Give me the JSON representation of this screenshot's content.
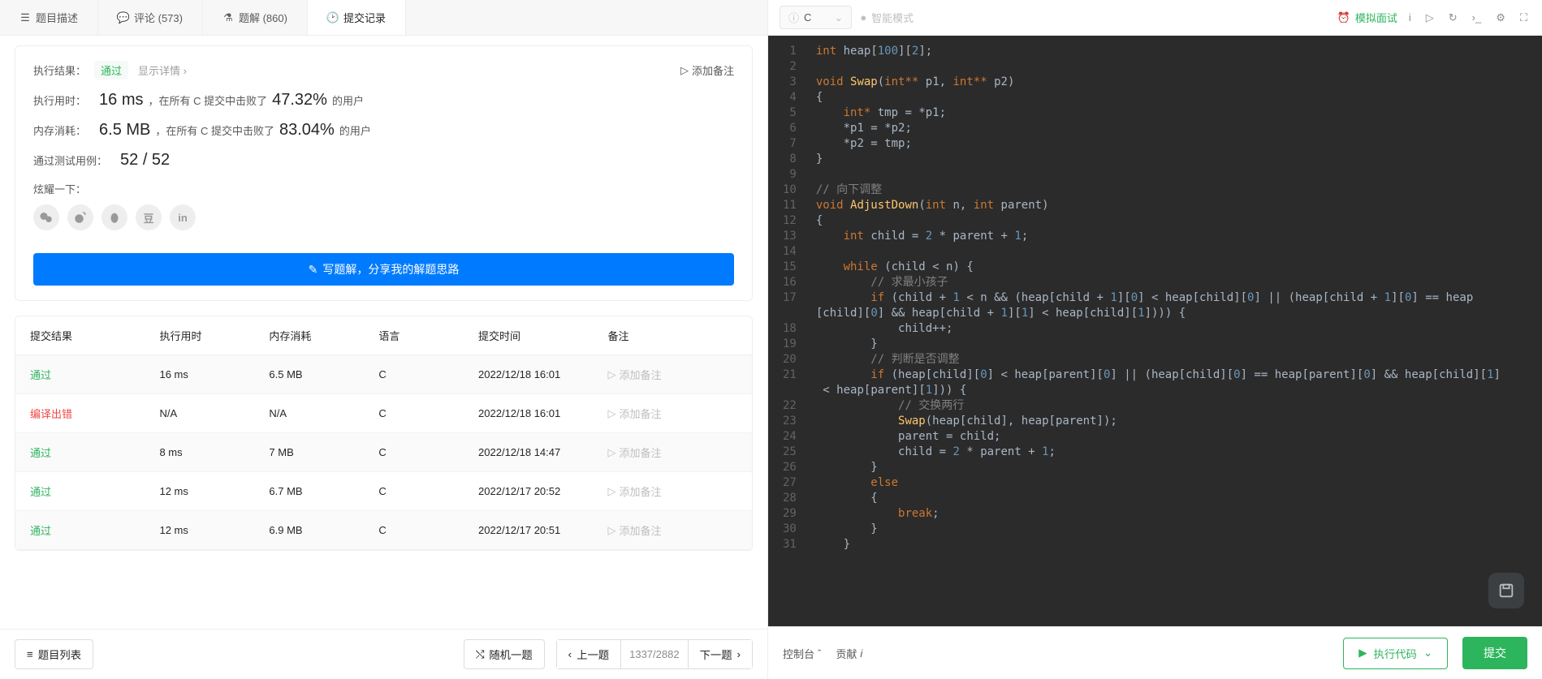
{
  "tabs": {
    "desc": "题目描述",
    "comments": "评论 (573)",
    "solutions": "题解 (860)",
    "submissions": "提交记录",
    "active": "submissions"
  },
  "result": {
    "label": "执行结果：",
    "status": "通过",
    "detail": "显示详情 ›",
    "addnote": "添加备注",
    "runtime_label": "执行用时：",
    "runtime_value": "16 ms",
    "runtime_text1": "，在所有 C 提交中击败了",
    "runtime_pct": "47.32%",
    "runtime_text2": "的用户",
    "memory_label": "内存消耗：",
    "memory_value": "6.5 MB",
    "memory_text1": "，在所有 C 提交中击败了",
    "memory_pct": "83.04%",
    "memory_text2": "的用户",
    "cases_label": "通过测试用例：",
    "cases_value": "52 / 52",
    "share_label": "炫耀一下：",
    "write_btn": "写题解，分享我的解题思路"
  },
  "table": {
    "headers": [
      "提交结果",
      "执行用时",
      "内存消耗",
      "语言",
      "提交时间",
      "备注"
    ],
    "rows": [
      {
        "status": "通过",
        "ok": true,
        "runtime": "16 ms",
        "memory": "6.5 MB",
        "lang": "C",
        "time": "2022/12/18 16:01",
        "note": "添加备注"
      },
      {
        "status": "编译出错",
        "ok": false,
        "runtime": "N/A",
        "memory": "N/A",
        "lang": "C",
        "time": "2022/12/18 16:01",
        "note": "添加备注"
      },
      {
        "status": "通过",
        "ok": true,
        "runtime": "8 ms",
        "memory": "7 MB",
        "lang": "C",
        "time": "2022/12/18 14:47",
        "note": "添加备注"
      },
      {
        "status": "通过",
        "ok": true,
        "runtime": "12 ms",
        "memory": "6.7 MB",
        "lang": "C",
        "time": "2022/12/17 20:52",
        "note": "添加备注"
      },
      {
        "status": "通过",
        "ok": true,
        "runtime": "12 ms",
        "memory": "6.9 MB",
        "lang": "C",
        "time": "2022/12/17 20:51",
        "note": "添加备注"
      }
    ]
  },
  "nav": {
    "list": "题目列表",
    "random": "随机一题",
    "prev": "上一题",
    "next": "下一题",
    "counter": "1337/2882"
  },
  "editor_top": {
    "language": "C",
    "smart": "智能模式",
    "mock": "模拟面试"
  },
  "editor_bottom": {
    "console": "控制台",
    "contribute": "贡献",
    "run": "执行代码",
    "submit": "提交"
  },
  "code": [
    {
      "n": 1,
      "html": "<span class='ty'>int</span> <span class='id'>heap</span>[<span class='num'>100</span>][<span class='num'>2</span>];"
    },
    {
      "n": 2,
      "html": ""
    },
    {
      "n": 3,
      "html": "<span class='ty'>void</span> <span class='fn'>Swap</span>(<span class='ty'>int**</span> <span class='id'>p1</span>, <span class='ty'>int**</span> <span class='id'>p2</span>)"
    },
    {
      "n": 4,
      "html": "{"
    },
    {
      "n": 5,
      "html": "    <span class='ty'>int*</span> <span class='id'>tmp</span> = *<span class='id'>p1</span>;"
    },
    {
      "n": 6,
      "html": "    *<span class='id'>p1</span> = *<span class='id'>p2</span>;"
    },
    {
      "n": 7,
      "html": "    *<span class='id'>p2</span> = <span class='id'>tmp</span>;"
    },
    {
      "n": 8,
      "html": "}"
    },
    {
      "n": 9,
      "html": ""
    },
    {
      "n": 10,
      "html": "<span class='cm'>// 向下调整</span>"
    },
    {
      "n": 11,
      "html": "<span class='ty'>void</span> <span class='fn'>AdjustDown</span>(<span class='ty'>int</span> <span class='id'>n</span>, <span class='ty'>int</span> <span class='id'>parent</span>)"
    },
    {
      "n": 12,
      "html": "{"
    },
    {
      "n": 13,
      "html": "    <span class='ty'>int</span> <span class='id'>child</span> = <span class='num'>2</span> * <span class='id'>parent</span> + <span class='num'>1</span>;"
    },
    {
      "n": 14,
      "html": ""
    },
    {
      "n": 15,
      "html": "    <span class='kw'>while</span> (<span class='id'>child</span> &lt; <span class='id'>n</span>) {"
    },
    {
      "n": 16,
      "html": "        <span class='cm'>// 求最小孩子</span>"
    },
    {
      "n": 17,
      "html": "        <span class='kw'>if</span> (<span class='id'>child</span> + <span class='num'>1</span> &lt; <span class='id'>n</span> &amp;&amp; (<span class='id'>heap</span>[<span class='id'>child</span> + <span class='num'>1</span>][<span class='num'>0</span>] &lt; <span class='id'>heap</span>[<span class='id'>child</span>][<span class='num'>0</span>] || (<span class='id'>heap</span>[<span class='id'>child</span> + <span class='num'>1</span>][<span class='num'>0</span>] == <span class='id'>heap</span>\n[<span class='id'>child</span>][<span class='num'>0</span>] &amp;&amp; <span class='id'>heap</span>[<span class='id'>child</span> + <span class='num'>1</span>][<span class='num'>1</span>] &lt; <span class='id'>heap</span>[<span class='id'>child</span>][<span class='num'>1</span>]))) {"
    },
    {
      "n": 18,
      "html": "            <span class='id'>child</span>++;"
    },
    {
      "n": 19,
      "html": "        }"
    },
    {
      "n": 20,
      "html": "        <span class='cm'>// 判断是否调整</span>"
    },
    {
      "n": 21,
      "html": "        <span class='kw'>if</span> (<span class='id'>heap</span>[<span class='id'>child</span>][<span class='num'>0</span>] &lt; <span class='id'>heap</span>[<span class='id'>parent</span>][<span class='num'>0</span>] || (<span class='id'>heap</span>[<span class='id'>child</span>][<span class='num'>0</span>] == <span class='id'>heap</span>[<span class='id'>parent</span>][<span class='num'>0</span>] &amp;&amp; <span class='id'>heap</span>[<span class='id'>child</span>][<span class='num'>1</span>]\n &lt; <span class='id'>heap</span>[<span class='id'>parent</span>][<span class='num'>1</span>])) {"
    },
    {
      "n": 22,
      "html": "            <span class='cm'>// 交换两行</span>"
    },
    {
      "n": 23,
      "html": "            <span class='fn'>Swap</span>(<span class='id'>heap</span>[<span class='id'>child</span>], <span class='id'>heap</span>[<span class='id'>parent</span>]);"
    },
    {
      "n": 24,
      "html": "            <span class='id'>parent</span> = <span class='id'>child</span>;"
    },
    {
      "n": 25,
      "html": "            <span class='id'>child</span> = <span class='num'>2</span> * <span class='id'>parent</span> + <span class='num'>1</span>;"
    },
    {
      "n": 26,
      "html": "        }"
    },
    {
      "n": 27,
      "html": "        <span class='kw'>else</span>"
    },
    {
      "n": 28,
      "html": "        {"
    },
    {
      "n": 29,
      "html": "            <span class='kw'>break</span>;"
    },
    {
      "n": 30,
      "html": "        }"
    },
    {
      "n": 31,
      "html": "    }"
    }
  ]
}
